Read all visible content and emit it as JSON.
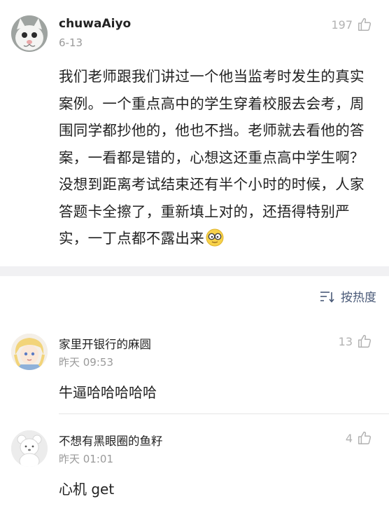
{
  "post": {
    "username": "chuwaAiyo",
    "date": "6-13",
    "likes": "197",
    "body": "我们老师跟我们讲过一个他当监考时发生的真实案例。一个重点高中的学生穿着校服去会考，周围同学都抄他的，他也不挡。老师就去看他的答案，一看都是错的，心想这还重点高中学生啊？没想到距离考试结束还有半个小时的时候，人家答题卡全擦了，重新填上对的，还捂得特别严实，一丁点都不露出来",
    "emoji_icon": "nerd-glasses-emoji-icon",
    "avatar_icon": "cat-avatar"
  },
  "sort": {
    "label": "按热度",
    "icon": "sort-icon"
  },
  "comments": [
    {
      "username": "家里开银行的麻圆",
      "time": "昨天 09:53",
      "likes": "13",
      "text": "牛逼哈哈哈哈哈",
      "avatar_icon": "anime-girl-avatar"
    },
    {
      "username": "不想有黑眼圈的鱼籽",
      "time": "昨天 01:01",
      "likes": "4",
      "text": "心机 get",
      "avatar_icon": "white-bear-avatar"
    }
  ],
  "colors": {
    "meta": "#9a9a9a",
    "like": "#b2b2b2",
    "sort": "#4a5a78",
    "band": "#f1f1f3"
  }
}
